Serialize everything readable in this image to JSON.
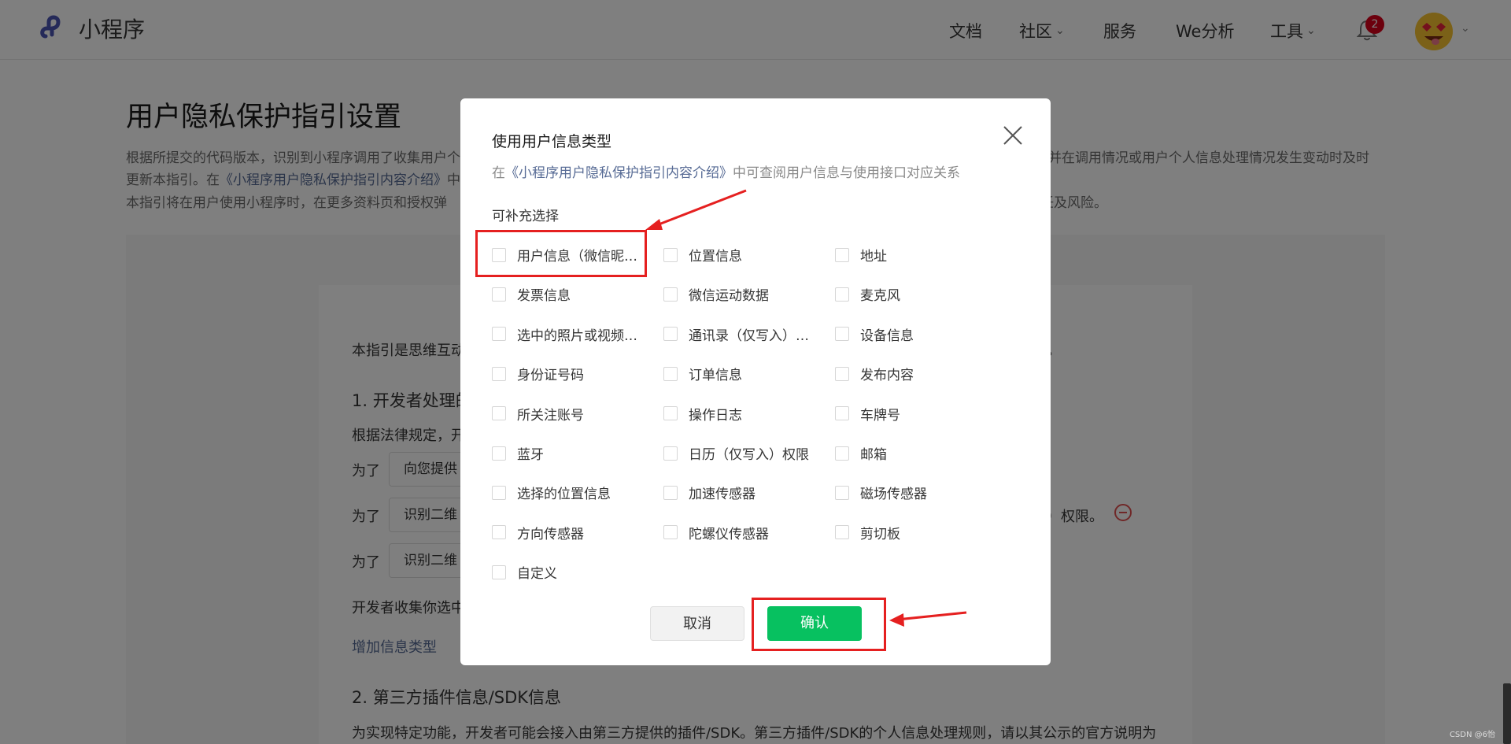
{
  "header": {
    "logo_text": "小程序",
    "nav": [
      {
        "label": "文档",
        "has_dropdown": false
      },
      {
        "label": "社区",
        "has_dropdown": true
      },
      {
        "label": "服务",
        "has_dropdown": false
      },
      {
        "label": "We分析",
        "has_dropdown": false
      },
      {
        "label": "工具",
        "has_dropdown": true
      }
    ],
    "notification_count": "2",
    "icons": [
      "miniprogram-logo-icon",
      "bell-icon",
      "avatar",
      "chevron-down-icon"
    ]
  },
  "page": {
    "title": "用户隐私保护指引设置",
    "desc_line1_start": "根据所提交的代码版本，识别到小程序调用了收集用户个",
    "desc_line1_end": "并在调用情况或用户个人信息处理情况发生变动时及时",
    "desc_line2_start": "更新本指引。在",
    "desc_line2_link": "《小程序用户隐私保护指引内容介绍》",
    "desc_line2_end": "中",
    "desc_line3_start": "本指引将在用户使用小程序时，在更多资料页和授权弹",
    "desc_line3_end": "任及风险。",
    "guide_intro": "本指引是思维互动",
    "guide_intro_end": "。",
    "section1_title": "1.  开发者处理的",
    "legal_text": "根据法律规定，开",
    "rows": [
      {
        "label": "为了",
        "value": "向您提供"
      },
      {
        "label": "为了",
        "value": "识别二维"
      },
      {
        "label": "为了",
        "value": "识别二维"
      }
    ],
    "row2_suffix": "）权限。",
    "collect_text": "开发者收集你选中",
    "add_info_link": "增加信息类型",
    "section2_title": "2.  第三方插件信息/SDK信息",
    "section2_text": "为实现特定功能，开发者可能会接入由第三方提供的插件/SDK。第三方插件/SDK的个人信息处理规则，请以其公示的官方说明为"
  },
  "dialog": {
    "title": "使用用户信息类型",
    "subtitle_prefix": "在",
    "subtitle_link": "《小程序用户隐私保护指引内容介绍》",
    "subtitle_suffix": "中可查阅用户信息与使用接口对应关系",
    "section_label": "可补充选择",
    "options": [
      "用户信息（微信昵…",
      "位置信息",
      "地址",
      "发票信息",
      "微信运动数据",
      "麦克风",
      "选中的照片或视频…",
      "通讯录（仅写入）…",
      "设备信息",
      "身份证号码",
      "订单信息",
      "发布内容",
      "所关注账号",
      "操作日志",
      "车牌号",
      "蓝牙",
      "日历（仅写入）权限",
      "邮箱",
      "选择的位置信息",
      "加速传感器",
      "磁场传感器",
      "方向传感器",
      "陀螺仪传感器",
      "剪切板",
      "自定义"
    ],
    "cancel_label": "取消",
    "confirm_label": "确认"
  },
  "watermark": "CSDN @6怡"
}
